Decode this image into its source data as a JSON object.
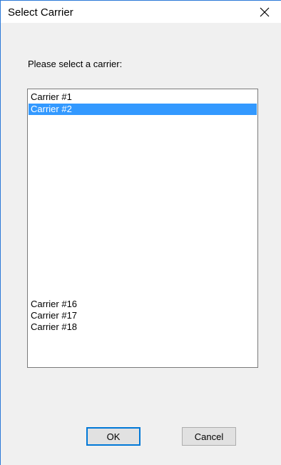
{
  "dialog": {
    "title": "Select Carrier",
    "close_icon": "close-icon",
    "prompt": "Please select a carrier:"
  },
  "list": {
    "items": [
      {
        "label": "Carrier #1",
        "selected": false
      },
      {
        "label": "Carrier #2",
        "selected": true
      },
      {
        "label": "Carrier #16",
        "selected": false
      },
      {
        "label": "Carrier #17",
        "selected": false
      },
      {
        "label": "Carrier #18",
        "selected": false
      }
    ],
    "selection_color": "#3399ff"
  },
  "buttons": {
    "ok_label": "OK",
    "cancel_label": "Cancel"
  },
  "colors": {
    "window_border": "#2b79d8",
    "default_button_border": "#0078d7"
  }
}
